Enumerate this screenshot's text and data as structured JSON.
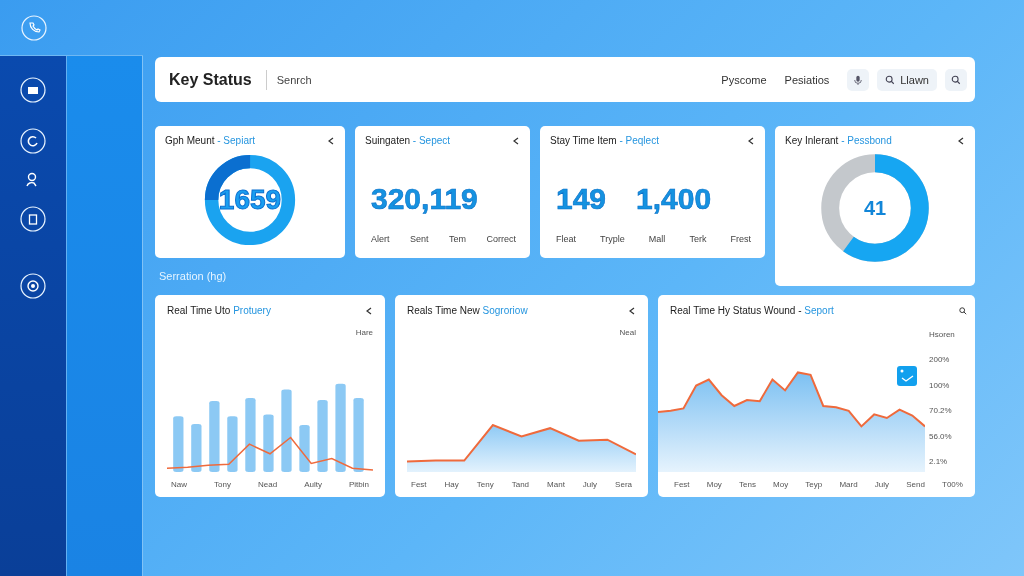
{
  "topbar": {
    "title": "Key Status",
    "search": {
      "placeholder": "Senrch"
    },
    "links": [
      "Pyscome",
      "Pesiatios"
    ],
    "button": "Llawn"
  },
  "stat_cards": [
    {
      "kind": "ring",
      "title": "Gph Meunt",
      "tag": "- Sepiart",
      "value": "1659",
      "level": 0.25
    },
    {
      "kind": "numbers",
      "title": "Suingaten",
      "tag": "- Sepect",
      "values": [
        "320,119"
      ],
      "labels": [
        "Alert",
        "Sent",
        "Tem",
        "Correct"
      ]
    },
    {
      "kind": "numbers",
      "title": "Stay Time Item",
      "tag": "- Peqlect",
      "values": [
        "149",
        "1,400"
      ],
      "labels": [
        "Fleat",
        "Tryple",
        "Mall",
        "Terk",
        "Frest"
      ]
    },
    {
      "kind": "donut",
      "title": "Key Inlerant",
      "tag": "- Pessbond",
      "value": "41",
      "level": 0.6
    }
  ],
  "section_label": "Serration (hg)",
  "chart_cards": [
    {
      "kind": "bars",
      "title": "Real Time Uto",
      "tag": "Protuery",
      "legend": "Hare",
      "x_labels": [
        "Naw",
        "Tony",
        "Nead",
        "Aulty",
        "Pitbin"
      ]
    },
    {
      "kind": "area",
      "title": "Reals Time New",
      "tag": "Sogroriow",
      "legend": "Neal",
      "x_labels": [
        "Fest",
        "Hay",
        "Teny",
        "Tand",
        "Mant",
        "July",
        "Sera"
      ]
    },
    {
      "kind": "area_axis",
      "title": "Real Time Hy Status Wound - ",
      "tag": "Seport",
      "y_labels": [
        "Hsoren",
        "200%",
        "100%",
        "70.2%",
        "56.0%",
        "2.1%"
      ],
      "x_labels": [
        "Fest",
        "Moy",
        "Tens",
        "Moy",
        "Teyp",
        "Mard",
        "July",
        "Send",
        "T00%"
      ]
    }
  ]
}
